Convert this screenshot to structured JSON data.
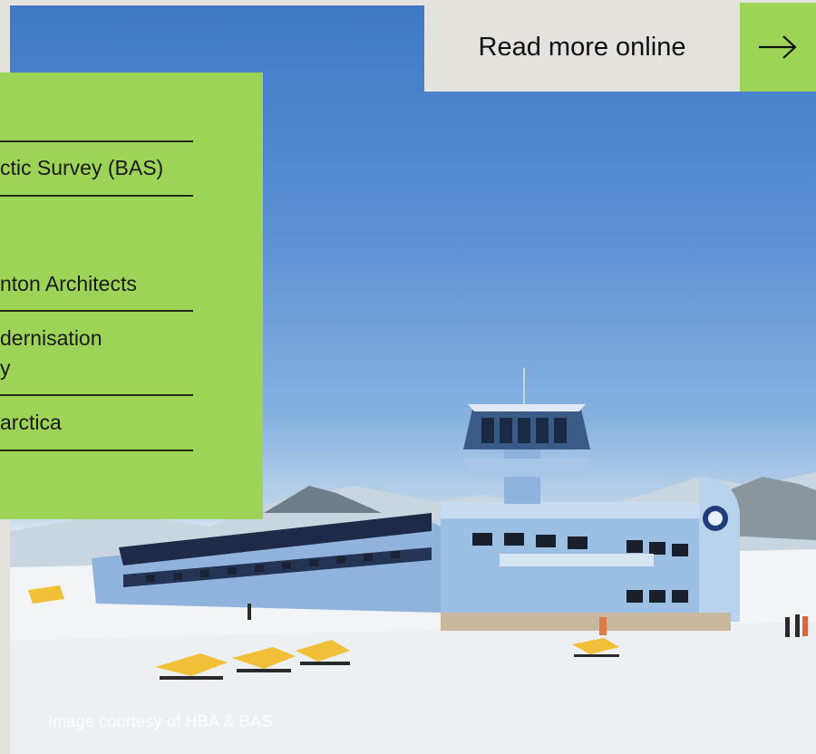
{
  "cta": {
    "label": "Read more online",
    "arrow_icon": "arrow-right-icon"
  },
  "info_panel": {
    "rows": [
      {
        "text": "ctic Survey (BAS)"
      },
      {
        "text": "nton Architects"
      },
      {
        "text_line1": "dernisation",
        "text_line2": "y"
      },
      {
        "text": "arctica"
      }
    ]
  },
  "hero": {
    "caption": "Image courtesy of HBA & BAS"
  },
  "colors": {
    "accent_green": "#9dd458",
    "panel_grey": "#e3e2dd"
  }
}
